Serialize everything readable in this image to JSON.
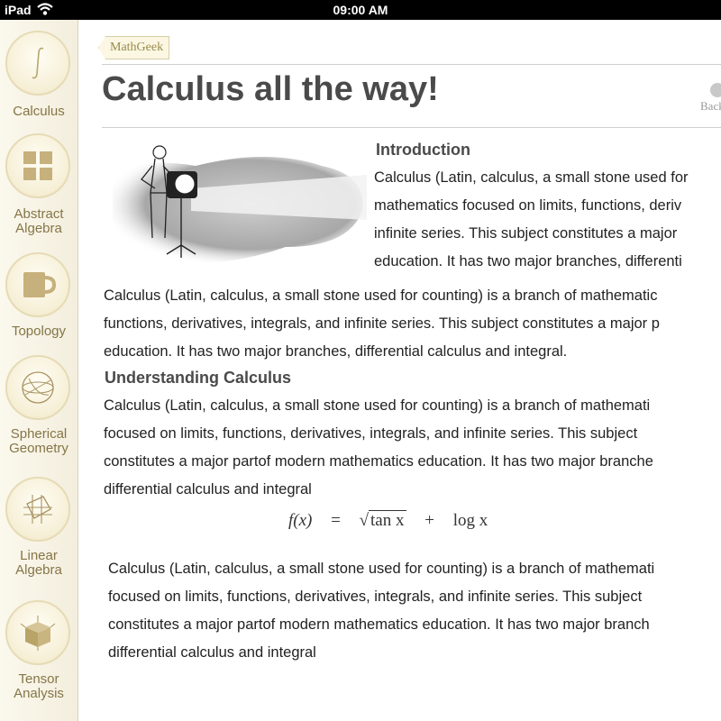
{
  "status_bar": {
    "device": "iPad",
    "time": "09:00 AM"
  },
  "sidebar": {
    "items": [
      {
        "label": "Calculus",
        "icon": "integral-icon"
      },
      {
        "label": "Abstract Algebra",
        "icon": "grid-icon"
      },
      {
        "label": "Topology",
        "icon": "mug-icon"
      },
      {
        "label": "Spherical Geometry",
        "icon": "sphere-icon"
      },
      {
        "label": "Linear Algebra",
        "icon": "plane-grid-icon"
      },
      {
        "label": "Tensor Analysis",
        "icon": "cube-icon"
      }
    ]
  },
  "header": {
    "breadcrumb": "MathGeek",
    "title": "Calculus all the way!",
    "back_label": "Back"
  },
  "intro": {
    "heading": "Introduction",
    "lines": [
      "Calculus (Latin, calculus, a small stone used for",
      "mathematics focused on limits, functions, deriv",
      "infinite series. This subject constitutes a major",
      "education. It has two major branches, differenti"
    ]
  },
  "paragraph1": {
    "lines": [
      "Calculus (Latin, calculus, a small stone used for counting) is a branch of mathematic",
      "functions, derivatives, integrals, and infinite series. This subject constitutes a major p",
      "education. It has two major branches, differential calculus and integral."
    ]
  },
  "understanding": {
    "heading": "Understanding Calculus",
    "lines": [
      "Calculus (Latin, calculus, a small stone used for counting) is a branch of mathemati",
      "focused on limits, functions, derivatives, integrals, and infinite series. This subject",
      "constitutes a major partof modern mathematics education. It has two major branche",
      "differential calculus and integral"
    ]
  },
  "formula": {
    "lhs": "f(x)",
    "eq": "=",
    "sqrt_arg": "tan x",
    "plus": "+",
    "log": "log x"
  },
  "paragraph2": {
    "lines": [
      "Calculus (Latin, calculus, a small stone used for counting) is a branch of mathemati",
      "focused on limits, functions, derivatives, integrals, and infinite series. This subject",
      "constitutes a major partof modern mathematics education. It has two major branch",
      "differential calculus and integral"
    ]
  }
}
